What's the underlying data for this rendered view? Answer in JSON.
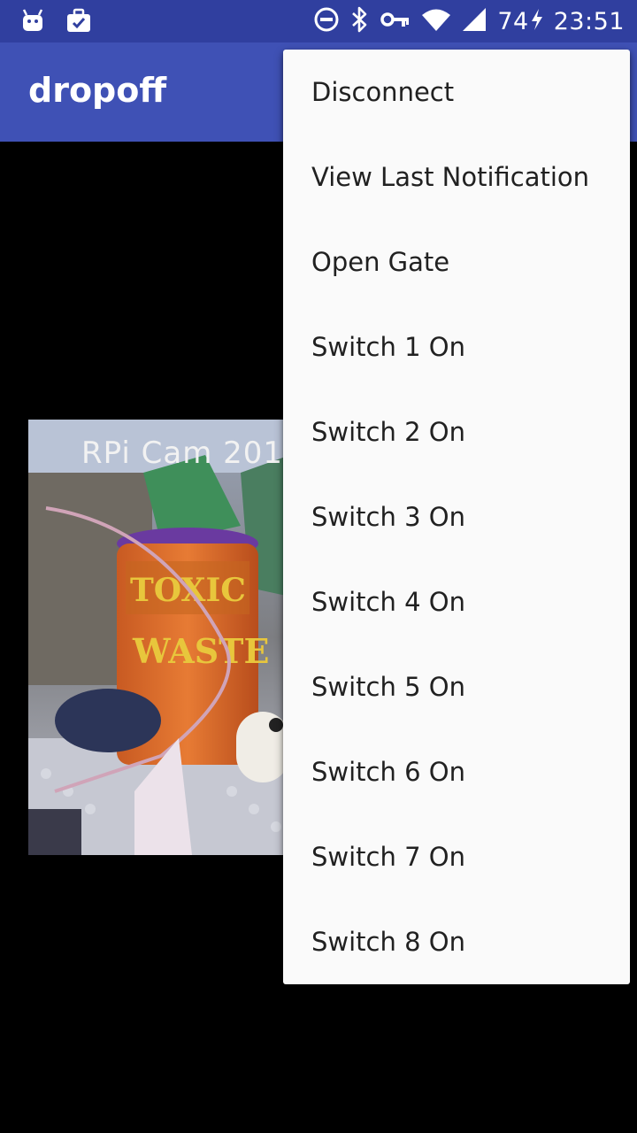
{
  "status_bar": {
    "battery_level": "74",
    "time": "23:51",
    "icons": [
      "android-icon",
      "briefcase-check-icon",
      "do-not-disturb-icon",
      "bluetooth-icon",
      "vpn-key-icon",
      "wifi-icon",
      "cell-signal-icon",
      "charging-bolt-icon"
    ]
  },
  "app_bar": {
    "title": "dropoff"
  },
  "camera": {
    "overlay_text": "RPi  Cam  201"
  },
  "menu": {
    "items": [
      {
        "label": "Disconnect"
      },
      {
        "label": "View Last Notification"
      },
      {
        "label": "Open Gate"
      },
      {
        "label": "Switch 1 On"
      },
      {
        "label": "Switch 2 On"
      },
      {
        "label": "Switch 3 On"
      },
      {
        "label": "Switch 4 On"
      },
      {
        "label": "Switch 5 On"
      },
      {
        "label": "Switch 6 On"
      },
      {
        "label": "Switch 7 On"
      },
      {
        "label": "Switch 8 On"
      }
    ]
  },
  "colors": {
    "status_bar": "#303f9f",
    "app_bar": "#3f51b5",
    "menu_background": "#fafafa",
    "menu_text": "#212121",
    "background": "#000000"
  }
}
